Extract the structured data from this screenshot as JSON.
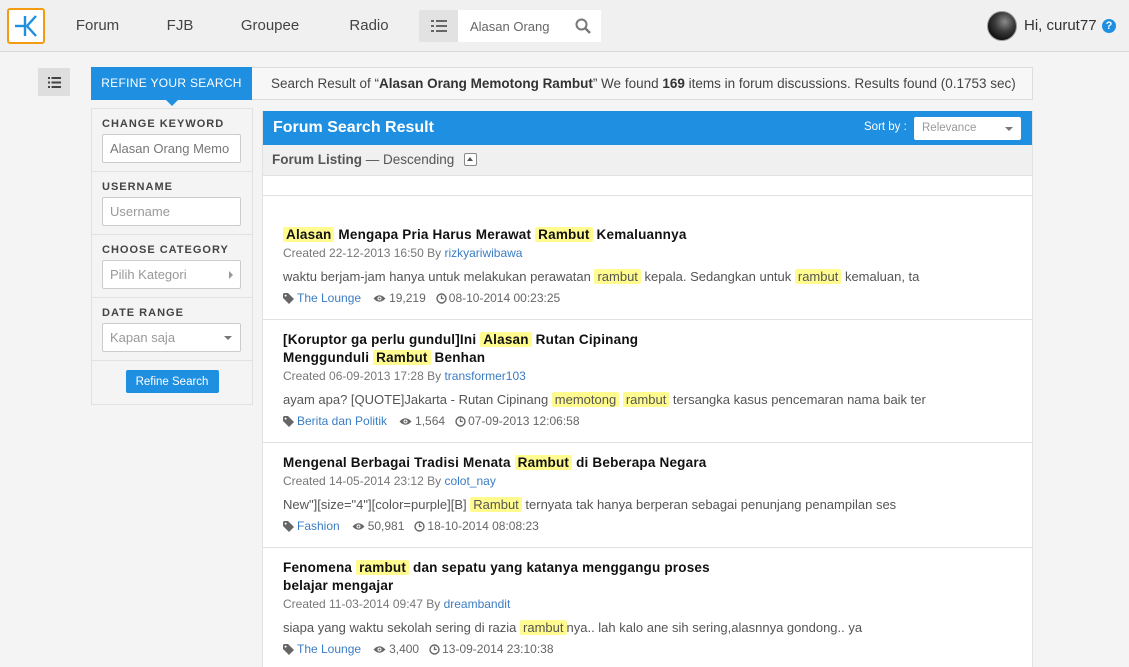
{
  "nav": {
    "items": [
      {
        "label": "Forum",
        "active": true
      },
      {
        "label": "FJB",
        "active": false
      },
      {
        "label": "Groupee",
        "active": false
      },
      {
        "label": "Radio",
        "active": false
      }
    ],
    "search_value": "Alasan Orang",
    "greeting": "Hi, curut77",
    "help_glyph": "?"
  },
  "colors": {
    "accent": "#1e8fe1",
    "logo_border": "#f39c12",
    "highlight": "#fffb8f",
    "link": "#3b7dc4"
  },
  "refine": {
    "tab_label": "REFINE YOUR SEARCH",
    "summary": {
      "prefix": "Search Result of “",
      "query": "Alasan Orang Memotong Rambut",
      "middle": "” We found ",
      "count": "169",
      "suffix": " items in forum discussions. Results found (0.1753 sec)"
    },
    "keyword_label": "CHANGE KEYWORD",
    "keyword_value": "Alasan Orang Memo",
    "username_label": "USERNAME",
    "username_placeholder": "Username",
    "category_label": "CHOOSE CATEGORY",
    "category_placeholder": "Pilih Kategori",
    "date_label": "DATE RANGE",
    "date_value": "Kapan saja",
    "button_label": "Refine Search"
  },
  "results": {
    "title": "Forum Search Result",
    "sort_label": "Sort by :",
    "sort_value": "Relevance",
    "listing_label": "Forum Listing",
    "listing_order": " — Descending",
    "items": [
      {
        "title_parts": [
          {
            "t": "Alasan",
            "hl": true
          },
          {
            "t": " Mengapa Pria Harus Merawat ",
            "hl": false
          },
          {
            "t": "Rambut",
            "hl": true
          },
          {
            "t": " Kemaluannya",
            "hl": false
          }
        ],
        "created": "Created 22-12-2013 16:50 By ",
        "user": "rizkyariwibawa",
        "snippet_parts": [
          {
            "t": "waktu berjam-jam hanya untuk melakukan perawatan ",
            "hl": false
          },
          {
            "t": "rambut",
            "hl": true
          },
          {
            "t": " kepala. Sedangkan untuk ",
            "hl": false
          },
          {
            "t": "rambut",
            "hl": true
          },
          {
            "t": " kemaluan, ta",
            "hl": false
          }
        ],
        "category": "The Lounge",
        "views": "19,219",
        "last": "08-10-2014 00:23:25"
      },
      {
        "title_parts": [
          {
            "t": "[Koruptor ga perlu gundul]Ini ",
            "hl": false
          },
          {
            "t": "Alasan",
            "hl": true
          },
          {
            "t": " Rutan Cipinang",
            "hl": false
          },
          {
            "t": "BR",
            "hl": false
          },
          {
            "t": "Menggunduli ",
            "hl": false
          },
          {
            "t": "Rambut",
            "hl": true
          },
          {
            "t": " Benhan",
            "hl": false
          }
        ],
        "created": "Created 06-09-2013 17:28 By ",
        "user": "transformer103",
        "snippet_parts": [
          {
            "t": "ayam apa? [QUOTE]Jakarta - Rutan Cipinang ",
            "hl": false
          },
          {
            "t": "memotong",
            "hl": true
          },
          {
            "t": " ",
            "hl": false
          },
          {
            "t": "rambut",
            "hl": true
          },
          {
            "t": " tersangka kasus pencemaran nama baik ter",
            "hl": false
          }
        ],
        "category": "Berita dan Politik",
        "views": "1,564",
        "last": "07-09-2013 12:06:58"
      },
      {
        "title_parts": [
          {
            "t": "Mengenal Berbagai Tradisi Menata ",
            "hl": false
          },
          {
            "t": "Rambut",
            "hl": true
          },
          {
            "t": " di Beberapa Negara",
            "hl": false
          }
        ],
        "created": "Created 14-05-2014 23:12 By ",
        "user": "colot_nay",
        "snippet_parts": [
          {
            "t": "New\"][size=\"4\"][color=purple][B] ",
            "hl": false
          },
          {
            "t": "Rambut",
            "hl": true
          },
          {
            "t": " ternyata tak hanya berperan sebagai penunjang penampilan ses",
            "hl": false
          }
        ],
        "category": "Fashion",
        "views": "50,981",
        "last": "18-10-2014 08:08:23"
      },
      {
        "title_parts": [
          {
            "t": "Fenomena ",
            "hl": false
          },
          {
            "t": "rambut",
            "hl": true
          },
          {
            "t": " dan sepatu yang katanya menggangu proses",
            "hl": false
          },
          {
            "t": "BR",
            "hl": false
          },
          {
            "t": "belajar mengajar",
            "hl": false
          }
        ],
        "created": "Created 11-03-2014 09:47 By ",
        "user": "dreambandit",
        "snippet_parts": [
          {
            "t": "siapa yang waktu sekolah sering di razia ",
            "hl": false
          },
          {
            "t": "rambut",
            "hl": true
          },
          {
            "t": "nya.. lah kalo ane sih sering,alasnnya gondong.. ya",
            "hl": false
          }
        ],
        "category": "The Lounge",
        "views": "3,400",
        "last": "13-09-2014 23:10:38"
      }
    ]
  }
}
